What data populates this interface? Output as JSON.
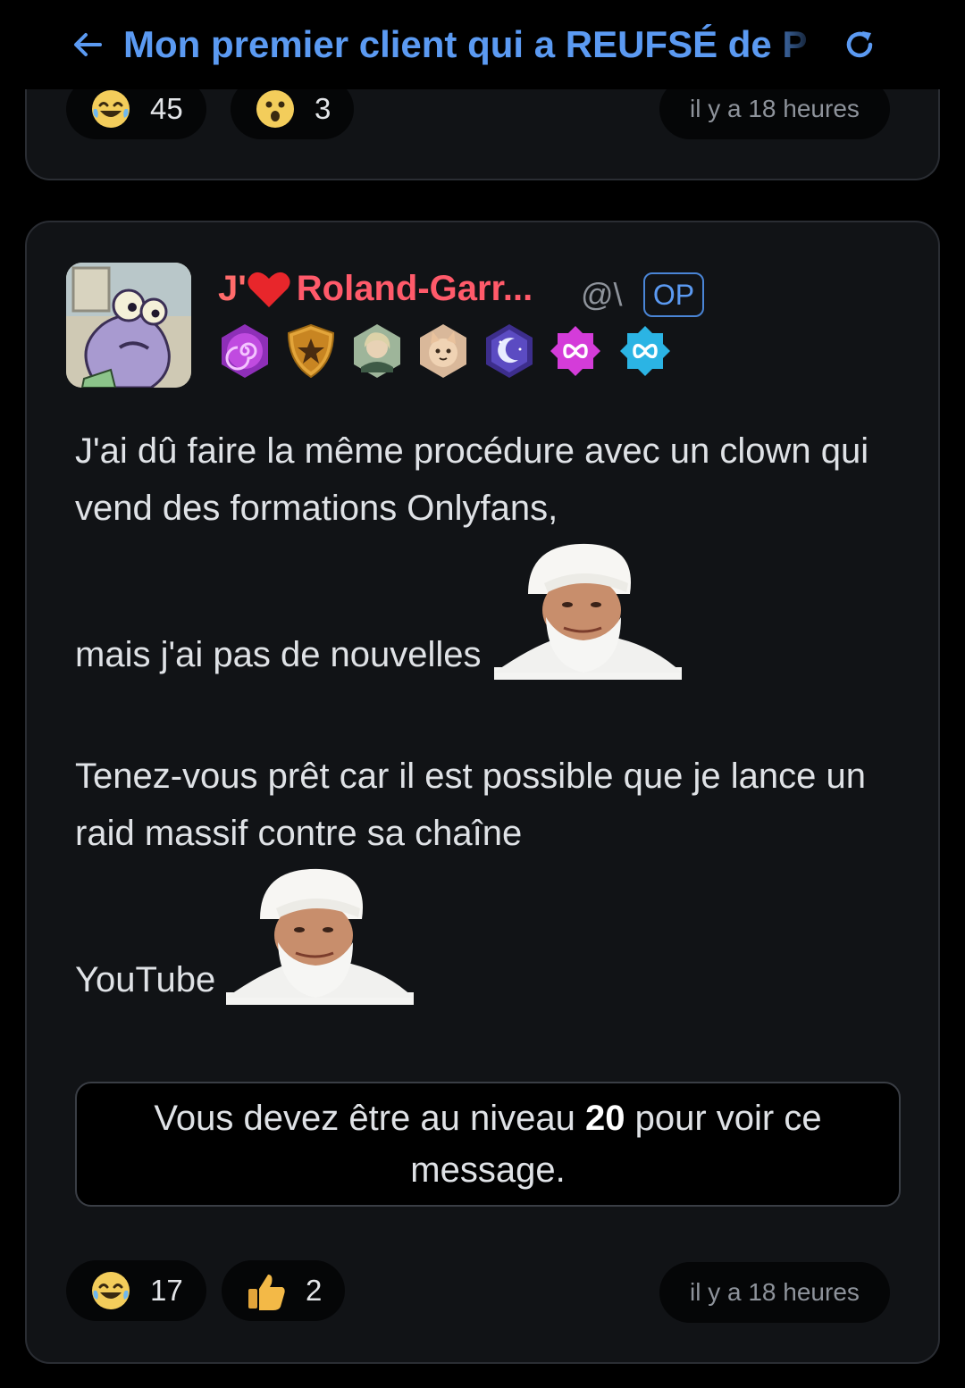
{
  "header": {
    "title": "Mon premier client qui a REUFSÉ de P"
  },
  "previous_post": {
    "reactions": [
      {
        "icon": "laughing-tears-emoji",
        "count": "45"
      },
      {
        "icon": "surprised-emoji",
        "count": "3"
      }
    ],
    "time": "il y a 18 heures"
  },
  "post": {
    "author": {
      "name_prefix": "J'",
      "name": "Roland-Garr...",
      "handle": "@\\",
      "op_label": "OP"
    },
    "badges": [
      "spiral-badge",
      "star-shield-badge",
      "portrait-badge",
      "cat-badge",
      "moon-badge",
      "infinity-pink-badge",
      "infinity-blue-badge"
    ],
    "body": {
      "line1": "J'ai dû faire la même procédure avec un clown qui vend des formations Onlyfans,",
      "line2": "mais j'ai pas de nouvelles",
      "line3": "Tenez-vous prêt car il est possible que je lance un raid massif contre sa chaîne",
      "line4": "YouTube"
    },
    "locked": {
      "before": "Vous devez être au niveau",
      "level": "20",
      "after": "pour voir ce message."
    },
    "reactions": [
      {
        "icon": "laughing-tears-emoji",
        "count": "17"
      },
      {
        "icon": "thumbs-up-emoji",
        "count": "2"
      }
    ],
    "time": "il y a 18 heures"
  },
  "colors": {
    "accent": "#5b9af2",
    "username": "#ff5a6a",
    "card_bg": "#111316",
    "page_bg": "#000000"
  }
}
